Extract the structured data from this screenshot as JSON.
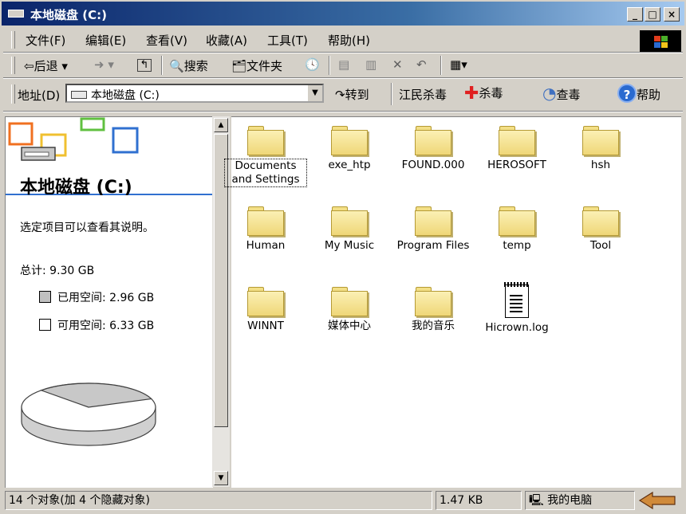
{
  "window": {
    "title": "本地磁盘 (C:)"
  },
  "menu": [
    "文件(F)",
    "编辑(E)",
    "查看(V)",
    "收藏(A)",
    "工具(T)",
    "帮助(H)"
  ],
  "toolbar": {
    "back": "后退",
    "search": "搜索",
    "folders": "文件夹"
  },
  "address": {
    "label": "地址(D)",
    "value": "本地磁盘 (C:)",
    "go": "转到"
  },
  "antivirus": {
    "name": "江民杀毒",
    "scan": "杀毒",
    "check": "查毒",
    "help": "帮助"
  },
  "left": {
    "heading": "本地磁盘 (C:)",
    "desc": "选定项目可以查看其说明。",
    "total": "总计: 9.30 GB",
    "used": "已用空间: 2.96 GB",
    "free": "可用空间: 6.33 GB",
    "used_fraction": 0.318
  },
  "files": [
    {
      "name": "Documents and Settings",
      "type": "folder"
    },
    {
      "name": "exe_htp",
      "type": "folder"
    },
    {
      "name": "FOUND.000",
      "type": "folder"
    },
    {
      "name": "HEROSOFT",
      "type": "folder"
    },
    {
      "name": "hsh",
      "type": "folder"
    },
    {
      "name": "Human",
      "type": "folder"
    },
    {
      "name": "My Music",
      "type": "folder"
    },
    {
      "name": "Program Files",
      "type": "folder"
    },
    {
      "name": "temp",
      "type": "folder"
    },
    {
      "name": "Tool",
      "type": "folder"
    },
    {
      "name": "WINNT",
      "type": "folder"
    },
    {
      "name": "媒体中心",
      "type": "folder"
    },
    {
      "name": "我的音乐",
      "type": "folder"
    },
    {
      "name": "Hicrown.log",
      "type": "file"
    }
  ],
  "status": {
    "objects": "14 个对象(加 4 个隐藏对象)",
    "size": "1.47 KB",
    "location": "我的电脑"
  }
}
